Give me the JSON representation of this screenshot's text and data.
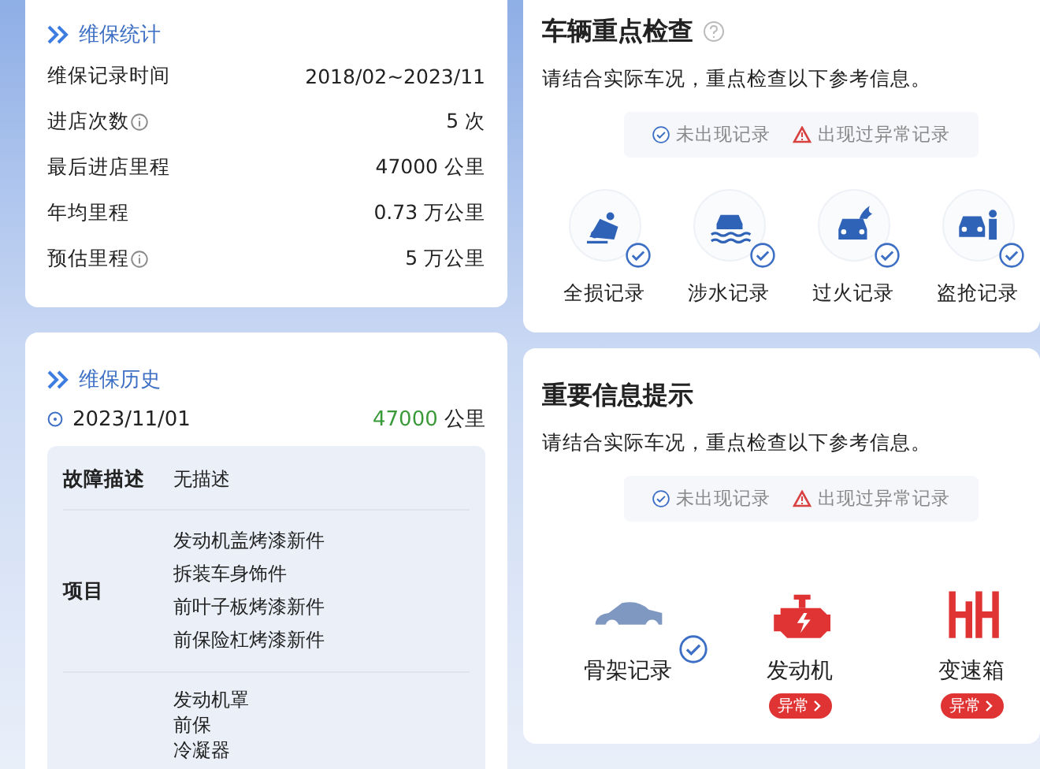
{
  "stats": {
    "title": "维保统计",
    "rows": [
      {
        "label": "维保记录时间",
        "info": false,
        "value": "2018/02~2023/11"
      },
      {
        "label": "进店次数",
        "info": true,
        "value": "5 次"
      },
      {
        "label": "最后进店里程",
        "info": false,
        "value": "47000 公里"
      },
      {
        "label": "年均里程",
        "info": false,
        "value": "0.73 万公里"
      },
      {
        "label": "预估里程",
        "info": true,
        "value": "5 万公里"
      }
    ]
  },
  "history": {
    "title": "维保历史",
    "entries": [
      {
        "date": "2023/11/01",
        "mileage": "47000",
        "unit": "公里",
        "details": [
          {
            "kind": "text",
            "label": "故障描述",
            "items": [
              "无描述"
            ]
          },
          {
            "kind": "list",
            "label": "项目",
            "items": [
              "发动机盖烤漆新件",
              "拆装车身饰件",
              "前叶子板烤漆新件",
              "前保险杠烤漆新件"
            ]
          },
          {
            "kind": "compact",
            "items": [
              "发动机罩",
              "前保",
              "冷凝器"
            ]
          }
        ]
      }
    ]
  },
  "checks": [
    {
      "title": "车辆重点检查",
      "help": true,
      "subtitle": "请结合实际车况，重点检查以下参考信息。",
      "legend": [
        {
          "kind": "ok",
          "label": "未出现记录"
        },
        {
          "kind": "abnormal",
          "label": "出现过异常记录"
        }
      ],
      "items": [
        {
          "label": "全损记录",
          "kind": "ok"
        },
        {
          "label": "涉水记录",
          "kind": "ok"
        },
        {
          "label": "过火记录",
          "kind": "ok"
        },
        {
          "label": "盗抢记录",
          "kind": "ok"
        }
      ]
    },
    {
      "title": "重要信息提示",
      "help": false,
      "subtitle": "请结合实际车况，重点检查以下参考信息。",
      "legend": [
        {
          "kind": "ok",
          "label": "未出现记录"
        },
        {
          "kind": "abnormal",
          "label": "出现过异常记录"
        }
      ],
      "items": [
        {
          "label": "骨架记录",
          "kind": "ok"
        },
        {
          "label": "发动机",
          "kind": "abnormal",
          "badge": "异常"
        },
        {
          "label": "变速箱",
          "kind": "abnormal",
          "badge": "异常"
        }
      ]
    }
  ]
}
